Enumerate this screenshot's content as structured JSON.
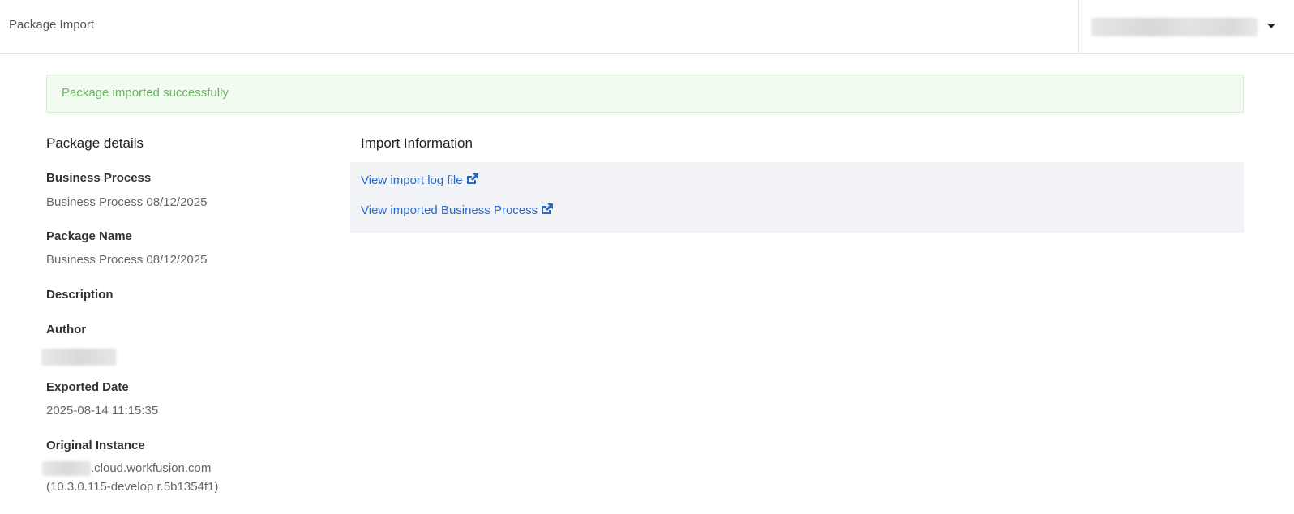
{
  "header": {
    "title": "Package Import",
    "user_menu_icon": "caret-down-icon"
  },
  "alert": {
    "message": "Package imported successfully",
    "color": "#6ab463"
  },
  "details": {
    "title": "Package details",
    "business_process_label": "Business Process",
    "business_process_value": "Business Process 08/12/2025",
    "package_name_label": "Package Name",
    "package_name_value": "Business Process 08/12/2025",
    "description_label": "Description",
    "author_label": "Author",
    "exported_date_label": "Exported Date",
    "exported_date_value": "2025-08-14 11:15:35",
    "original_instance_label": "Original Instance",
    "original_instance_domain": ".cloud.workfusion.com",
    "original_instance_version": "(10.3.0.115-develop r.5b1354f1)"
  },
  "import_info": {
    "title": "Import Information",
    "log_link": "View import log file",
    "bp_link": "View imported Business Process",
    "link_icon": "external-link-icon",
    "link_color": "#2a6ac8"
  }
}
